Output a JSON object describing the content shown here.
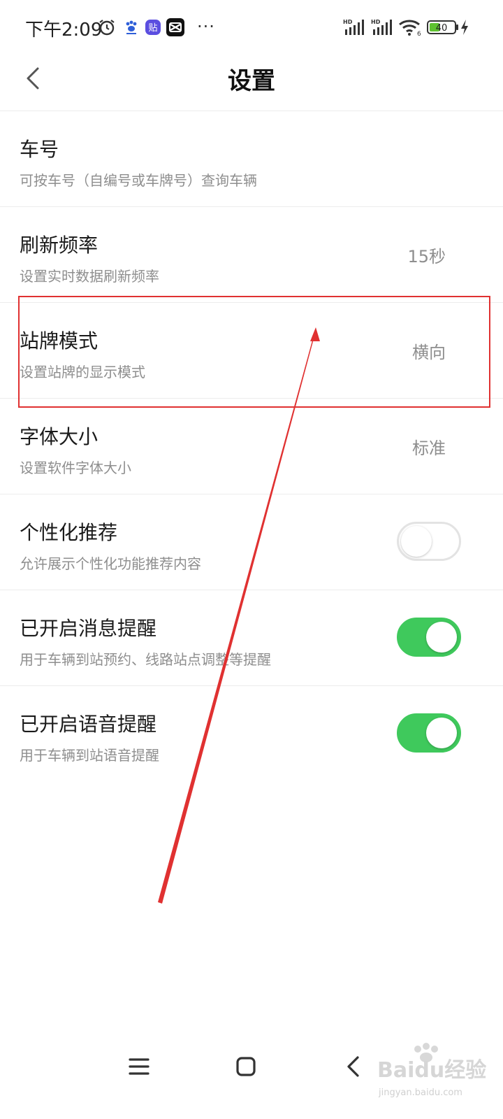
{
  "status_bar": {
    "time": "下午2:09",
    "signal_label_1": "HD",
    "signal_label_2": "HD",
    "wifi_label": "6",
    "battery_level": "40",
    "more": "···",
    "icons": [
      "alarm-icon",
      "baidu-paw-icon",
      "tieba-app-icon",
      "capcut-app-icon",
      "signal-icon",
      "wifi-icon",
      "battery-icon",
      "charging-icon"
    ]
  },
  "header": {
    "title": "设置",
    "back_icon": "chevron-left-icon"
  },
  "settings": [
    {
      "title": "车号",
      "subtitle": "可按车号（自编号或车牌号）查询车辆",
      "value": ""
    },
    {
      "title": "刷新频率",
      "subtitle": "设置实时数据刷新频率",
      "value": "15秒"
    },
    {
      "title": "站牌模式",
      "subtitle": "设置站牌的显示模式",
      "value": "横向"
    },
    {
      "title": "字体大小",
      "subtitle": "设置软件字体大小",
      "value": "标准"
    },
    {
      "title": "个性化推荐",
      "subtitle": "允许展示个性化功能推荐内容",
      "toggle": false
    },
    {
      "title": "已开启消息提醒",
      "subtitle": "用于车辆到站预约、线路站点调整等提醒",
      "toggle": true
    },
    {
      "title": "已开启语音提醒",
      "subtitle": "用于车辆到站语音提醒",
      "toggle": true
    }
  ],
  "nav_bar": {
    "icons": [
      "menu-icon",
      "home-square-icon",
      "back-chevron-icon"
    ]
  },
  "watermark": {
    "brand": "Baidu经验",
    "url": "jingyan.baidu.com"
  },
  "colors": {
    "toggle_on": "#3fc95c",
    "toggle_off_border": "#e3e3e3",
    "annotation": "#e03131",
    "battery_fill": "#5ec230"
  }
}
